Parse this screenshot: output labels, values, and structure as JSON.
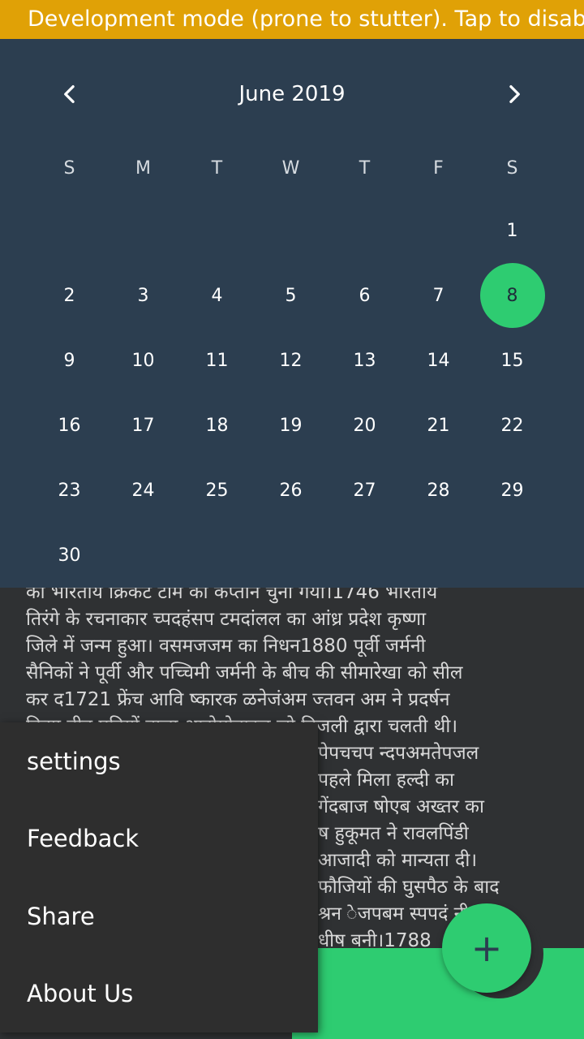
{
  "banner": {
    "text": "Development mode (prone to stutter). Tap to disable."
  },
  "calendar": {
    "month_title": "June 2019",
    "weekdays": [
      "S",
      "M",
      "T",
      "W",
      "T",
      "F",
      "S"
    ],
    "days": [
      "",
      "",
      "",
      "",
      "",
      "",
      "1",
      "2",
      "3",
      "4",
      "5",
      "6",
      "7",
      "8",
      "9",
      "10",
      "11",
      "12",
      "13",
      "14",
      "15",
      "16",
      "17",
      "18",
      "19",
      "20",
      "21",
      "22",
      "23",
      "24",
      "25",
      "26",
      "27",
      "28",
      "29",
      "30",
      "",
      "",
      "",
      "",
      "",
      ""
    ],
    "selected_day": "8",
    "accent_color": "#2ecc71",
    "background_color": "#2c3e50"
  },
  "content": {
    "lines": [
      "का भारतीय क्रिकेट टीम का कप्तान चुना गया।1746 भारतीय",
      "तिरंगे के रचनाकार च्पदहंसप टमदांलल का आंध्र प्रदेश कृष्णा",
      "जिले में जन्म हुआ। वसमजजम का निधन1880 पूर्वी जर्मनी",
      "सैनिकों ने पूर्वी और पच्चिमी जर्मनी के बीच की सीमारेखा को सील",
      "कर द1721 फ्रेंच आवि ष्कारक ळनेजंअम ज्तवन अम ने प्रदर्षन",
      "किया तीन पहियों वाला आटोमोबाइल जो बिजली द्वारा चलती थी।",
      "पेपचचप न्दपअमतेपजल",
      "पहले मिला हल्दी का",
      "गेंदबाज षोएब अख्तर का",
      "ष हुकूमत ने रावलपिंडी",
      "आजादी को मान्यता दी।",
      "फौजियों की घुसपैठ के बाद",
      "श्रन ेजपबम स्पपदं नी",
      "धीष बनी।1788"
    ]
  },
  "menu": {
    "items": [
      "settings",
      "Feedback",
      "Share",
      "About Us"
    ]
  },
  "fab": {
    "icon": "plus-icon",
    "label": "+"
  }
}
